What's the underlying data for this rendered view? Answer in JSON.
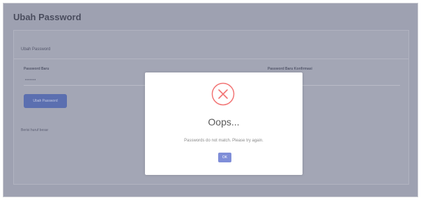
{
  "page": {
    "title": "Ubah Password"
  },
  "card": {
    "title": "Ubah Password",
    "new_password_label": "Password Baru",
    "new_password_value": "•••••••",
    "confirm_password_label": "Password Baru Konfirmasi",
    "save_label": "Ubah Password",
    "hint": "Berisi huruf besar"
  },
  "dialog": {
    "icon": "error-x-icon",
    "title": "Oops...",
    "message": "Passwords do not match. Please try again.",
    "ok_label": "OK",
    "accent": "#f27474",
    "button_color": "#7f8ed8"
  }
}
